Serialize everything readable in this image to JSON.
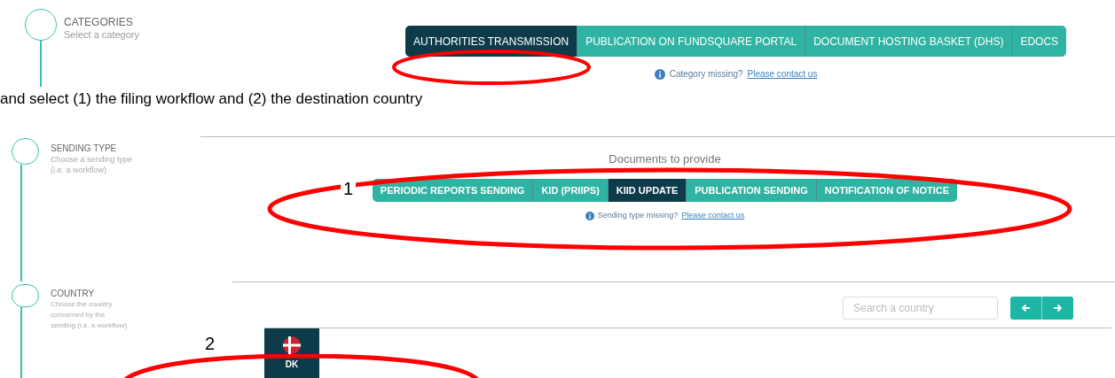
{
  "categories": {
    "title": "CATEGORIES",
    "subtitle": [
      "Select a category"
    ],
    "tabs": [
      {
        "label": "AUTHORITIES TRANSMISSION",
        "selected": true
      },
      {
        "label": "PUBLICATION ON FUNDSQUARE PORTAL",
        "selected": false
      },
      {
        "label": "DOCUMENT HOSTING BASKET (DHS)",
        "selected": false
      },
      {
        "label": "EDOCS",
        "selected": false
      }
    ],
    "info": {
      "text": "Category missing?",
      "link": "Please contact us"
    }
  },
  "caption": "and select (1) the filing workflow and (2) the destination country",
  "sending_type": {
    "title": "SENDING TYPE",
    "subtitle": [
      "Choose a sending type",
      "(i.e. a workflow)"
    ],
    "heading": "Documents to provide",
    "tabs": [
      {
        "label": "PERIODIC REPORTS SENDING",
        "selected": false
      },
      {
        "label": "KID (PRIIPS)",
        "selected": false
      },
      {
        "label": "KIID UPDATE",
        "selected": true
      },
      {
        "label": "PUBLICATION SENDING",
        "selected": false
      },
      {
        "label": "NOTIFICATION OF NOTICE",
        "selected": false
      }
    ],
    "info": {
      "text": "Sending type missing?",
      "link": "Please contact us"
    }
  },
  "country": {
    "title": "COUNTRY",
    "subtitle": [
      "Choose the country",
      "concerned by the",
      "sending (i.e. a workflow)"
    ],
    "search": {
      "placeholder": "Search a country"
    },
    "countries": [
      {
        "code": "DK",
        "selected": true
      }
    ]
  },
  "annotation_labels": [
    "1",
    "2"
  ]
}
